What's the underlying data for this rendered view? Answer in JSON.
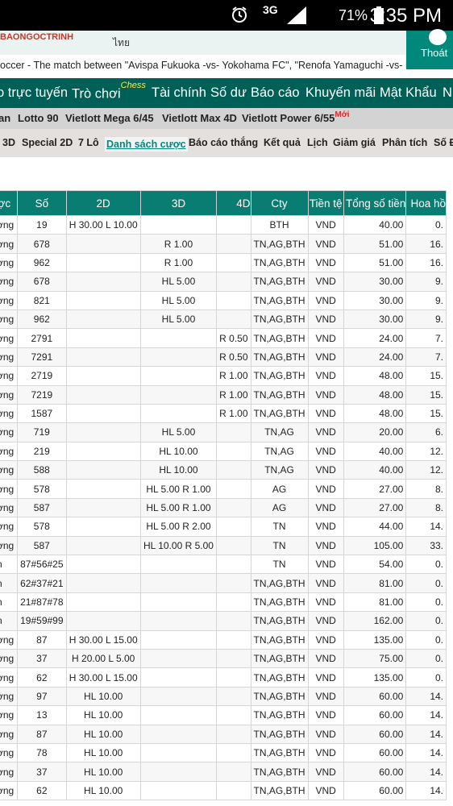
{
  "status_bar": {
    "time": "3:35 PM",
    "battery": "71%",
    "network": "3G"
  },
  "header": {
    "username": "BAONGOCTRINH",
    "lang_text": "ไทย",
    "logout_label": "Thoát"
  },
  "marquee": "occer - The match between \"Avispa Fukuoka -vs- Yokohama FC\", \"Renofa Yamaguchi -vs- FC N",
  "main_nav": {
    "items": [
      "o trực tuyến",
      "Trò chơi",
      "Tài chính",
      "Số dư",
      "Báo cáo",
      "Khuyến mãi",
      "Mật Khẩu",
      "N"
    ],
    "chess_badge": "Chess"
  },
  "sub_nav": {
    "items": [
      "an",
      "Lotto 90",
      "Vietlott Mega 6/45",
      "Vietlott Max 4D",
      "Vietlott Power 6/55"
    ],
    "new_badge": "Mới"
  },
  "sub_nav2": {
    "items": [
      "3D",
      "Special 2D",
      "7 Lô",
      "Danh sách cược",
      "Báo cáo thắng",
      "Kết quả",
      "Lịch",
      "Giảm giá",
      "Phân tích",
      "Số Đ"
    ]
  },
  "table": {
    "headers": [
      "rợc",
      "Số",
      "2D",
      "3D",
      "4D",
      "Cty",
      "Tiền tệ",
      "Tổng số tiền",
      "Hoa hồ"
    ],
    "rows": [
      [
        "ờng",
        "19",
        "H 30.00 L 10.00",
        "",
        "",
        "BTH",
        "VND",
        "40.00",
        "0."
      ],
      [
        "ờng",
        "678",
        "",
        "R 1.00",
        "",
        "TN,AG,BTH",
        "VND",
        "51.00",
        "16."
      ],
      [
        "ờng",
        "962",
        "",
        "R 1.00",
        "",
        "TN,AG,BTH",
        "VND",
        "51.00",
        "16."
      ],
      [
        "ờng",
        "678",
        "",
        "HL 5.00",
        "",
        "TN,AG,BTH",
        "VND",
        "30.00",
        "9."
      ],
      [
        "ờng",
        "821",
        "",
        "HL 5.00",
        "",
        "TN,AG,BTH",
        "VND",
        "30.00",
        "9."
      ],
      [
        "ờng",
        "962",
        "",
        "HL 5.00",
        "",
        "TN,AG,BTH",
        "VND",
        "30.00",
        "9."
      ],
      [
        "ờng",
        "2791",
        "",
        "",
        "R 0.50",
        "TN,AG,BTH",
        "VND",
        "24.00",
        "7."
      ],
      [
        "ờng",
        "7291",
        "",
        "",
        "R 0.50",
        "TN,AG,BTH",
        "VND",
        "24.00",
        "7."
      ],
      [
        "ờng",
        "2719",
        "",
        "",
        "R 1.00",
        "TN,AG,BTH",
        "VND",
        "48.00",
        "15."
      ],
      [
        "ờng",
        "7219",
        "",
        "",
        "R 1.00",
        "TN,AG,BTH",
        "VND",
        "48.00",
        "15."
      ],
      [
        "ờng",
        "1587",
        "",
        "",
        "R 1.00",
        "TN,AG,BTH",
        "VND",
        "48.00",
        "15."
      ],
      [
        "ờng",
        "719",
        "",
        "HL 5.00",
        "",
        "TN,AG",
        "VND",
        "20.00",
        "6."
      ],
      [
        "ờng",
        "219",
        "",
        "HL 10.00",
        "",
        "TN,AG",
        "VND",
        "40.00",
        "12."
      ],
      [
        "ờng",
        "588",
        "",
        "HL 10.00",
        "",
        "TN,AG",
        "VND",
        "40.00",
        "12."
      ],
      [
        "ờng",
        "578",
        "",
        "HL 5.00 R 1.00",
        "",
        "AG",
        "VND",
        "27.00",
        "8."
      ],
      [
        "ờng",
        "587",
        "",
        "HL 5.00 R 1.00",
        "",
        "AG",
        "VND",
        "27.00",
        "8."
      ],
      [
        "ờng",
        "578",
        "",
        "HL 5.00 R 2.00",
        "",
        "TN",
        "VND",
        "44.00",
        "14."
      ],
      [
        "ờng",
        "587",
        "",
        "HL 10.00 R 5.00",
        "",
        "TN",
        "VND",
        "105.00",
        "33."
      ],
      [
        "n",
        "87#56#25",
        "",
        "",
        "",
        "TN",
        "VND",
        "54.00",
        "0."
      ],
      [
        "n",
        "62#37#21",
        "",
        "",
        "",
        "TN,AG,BTH",
        "VND",
        "81.00",
        "0."
      ],
      [
        "n",
        "21#87#78",
        "",
        "",
        "",
        "TN,AG,BTH",
        "VND",
        "81.00",
        "0."
      ],
      [
        "n",
        "19#59#99",
        "",
        "",
        "",
        "TN,AG,BTH",
        "VND",
        "162.00",
        "0."
      ],
      [
        "ờng",
        "87",
        "H 30.00 L 15.00",
        "",
        "",
        "TN,AG,BTH",
        "VND",
        "135.00",
        "0."
      ],
      [
        "ờng",
        "37",
        "H 20.00 L 5.00",
        "",
        "",
        "TN,AG,BTH",
        "VND",
        "75.00",
        "0."
      ],
      [
        "ờng",
        "62",
        "H 30.00 L 15.00",
        "",
        "",
        "TN,AG,BTH",
        "VND",
        "135.00",
        "0."
      ],
      [
        "ờng",
        "97",
        "HL 10.00",
        "",
        "",
        "TN,AG,BTH",
        "VND",
        "60.00",
        "14."
      ],
      [
        "ờng",
        "13",
        "HL 10.00",
        "",
        "",
        "TN,AG,BTH",
        "VND",
        "60.00",
        "14."
      ],
      [
        "ờng",
        "87",
        "HL 10.00",
        "",
        "",
        "TN,AG,BTH",
        "VND",
        "60.00",
        "14."
      ],
      [
        "ờng",
        "78",
        "HL 10.00",
        "",
        "",
        "TN,AG,BTH",
        "VND",
        "60.00",
        "14."
      ],
      [
        "ờng",
        "37",
        "HL 10.00",
        "",
        "",
        "TN,AG,BTH",
        "VND",
        "60.00",
        "14."
      ],
      [
        "ờng",
        "62",
        "HL 10.00",
        "",
        "",
        "TN,AG,BTH",
        "VND",
        "60.00",
        "14."
      ]
    ]
  }
}
